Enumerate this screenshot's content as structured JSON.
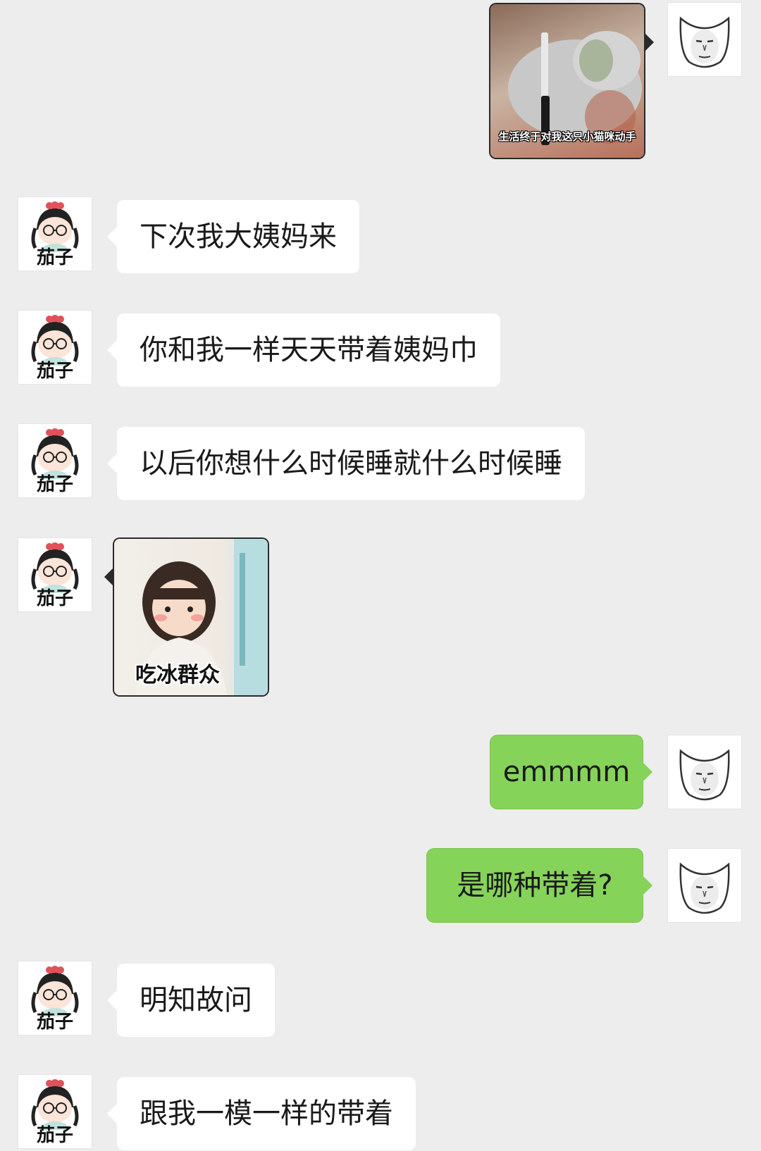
{
  "colors": {
    "background": "#ededed",
    "incoming_bubble": "#ffffff",
    "outgoing_bubble": "#86d35a"
  },
  "contact": {
    "avatar_icon": "girl-with-glasses-avatar",
    "avatar_caption": "茄子"
  },
  "me": {
    "avatar_icon": "cat-face-avatar"
  },
  "messages": [
    {
      "from": "me",
      "type": "sticker",
      "icon": "cat-with-knife-sticker",
      "caption": "生活终于对我这只小猫咪动手"
    },
    {
      "from": "contact",
      "type": "text",
      "text": "下次我大姨妈来"
    },
    {
      "from": "contact",
      "type": "text",
      "text": "你和我一样天天带着姨妈巾"
    },
    {
      "from": "contact",
      "type": "text",
      "text": "以后你想什么时候睡就什么时候睡"
    },
    {
      "from": "contact",
      "type": "sticker",
      "icon": "little-girl-sticker",
      "caption": "吃冰群众"
    },
    {
      "from": "me",
      "type": "text",
      "text": "emmmm"
    },
    {
      "from": "me",
      "type": "text",
      "text": "是哪种带着?"
    },
    {
      "from": "contact",
      "type": "text",
      "text": "明知故问"
    },
    {
      "from": "contact",
      "type": "text",
      "text": "跟我一模一样的带着"
    }
  ]
}
